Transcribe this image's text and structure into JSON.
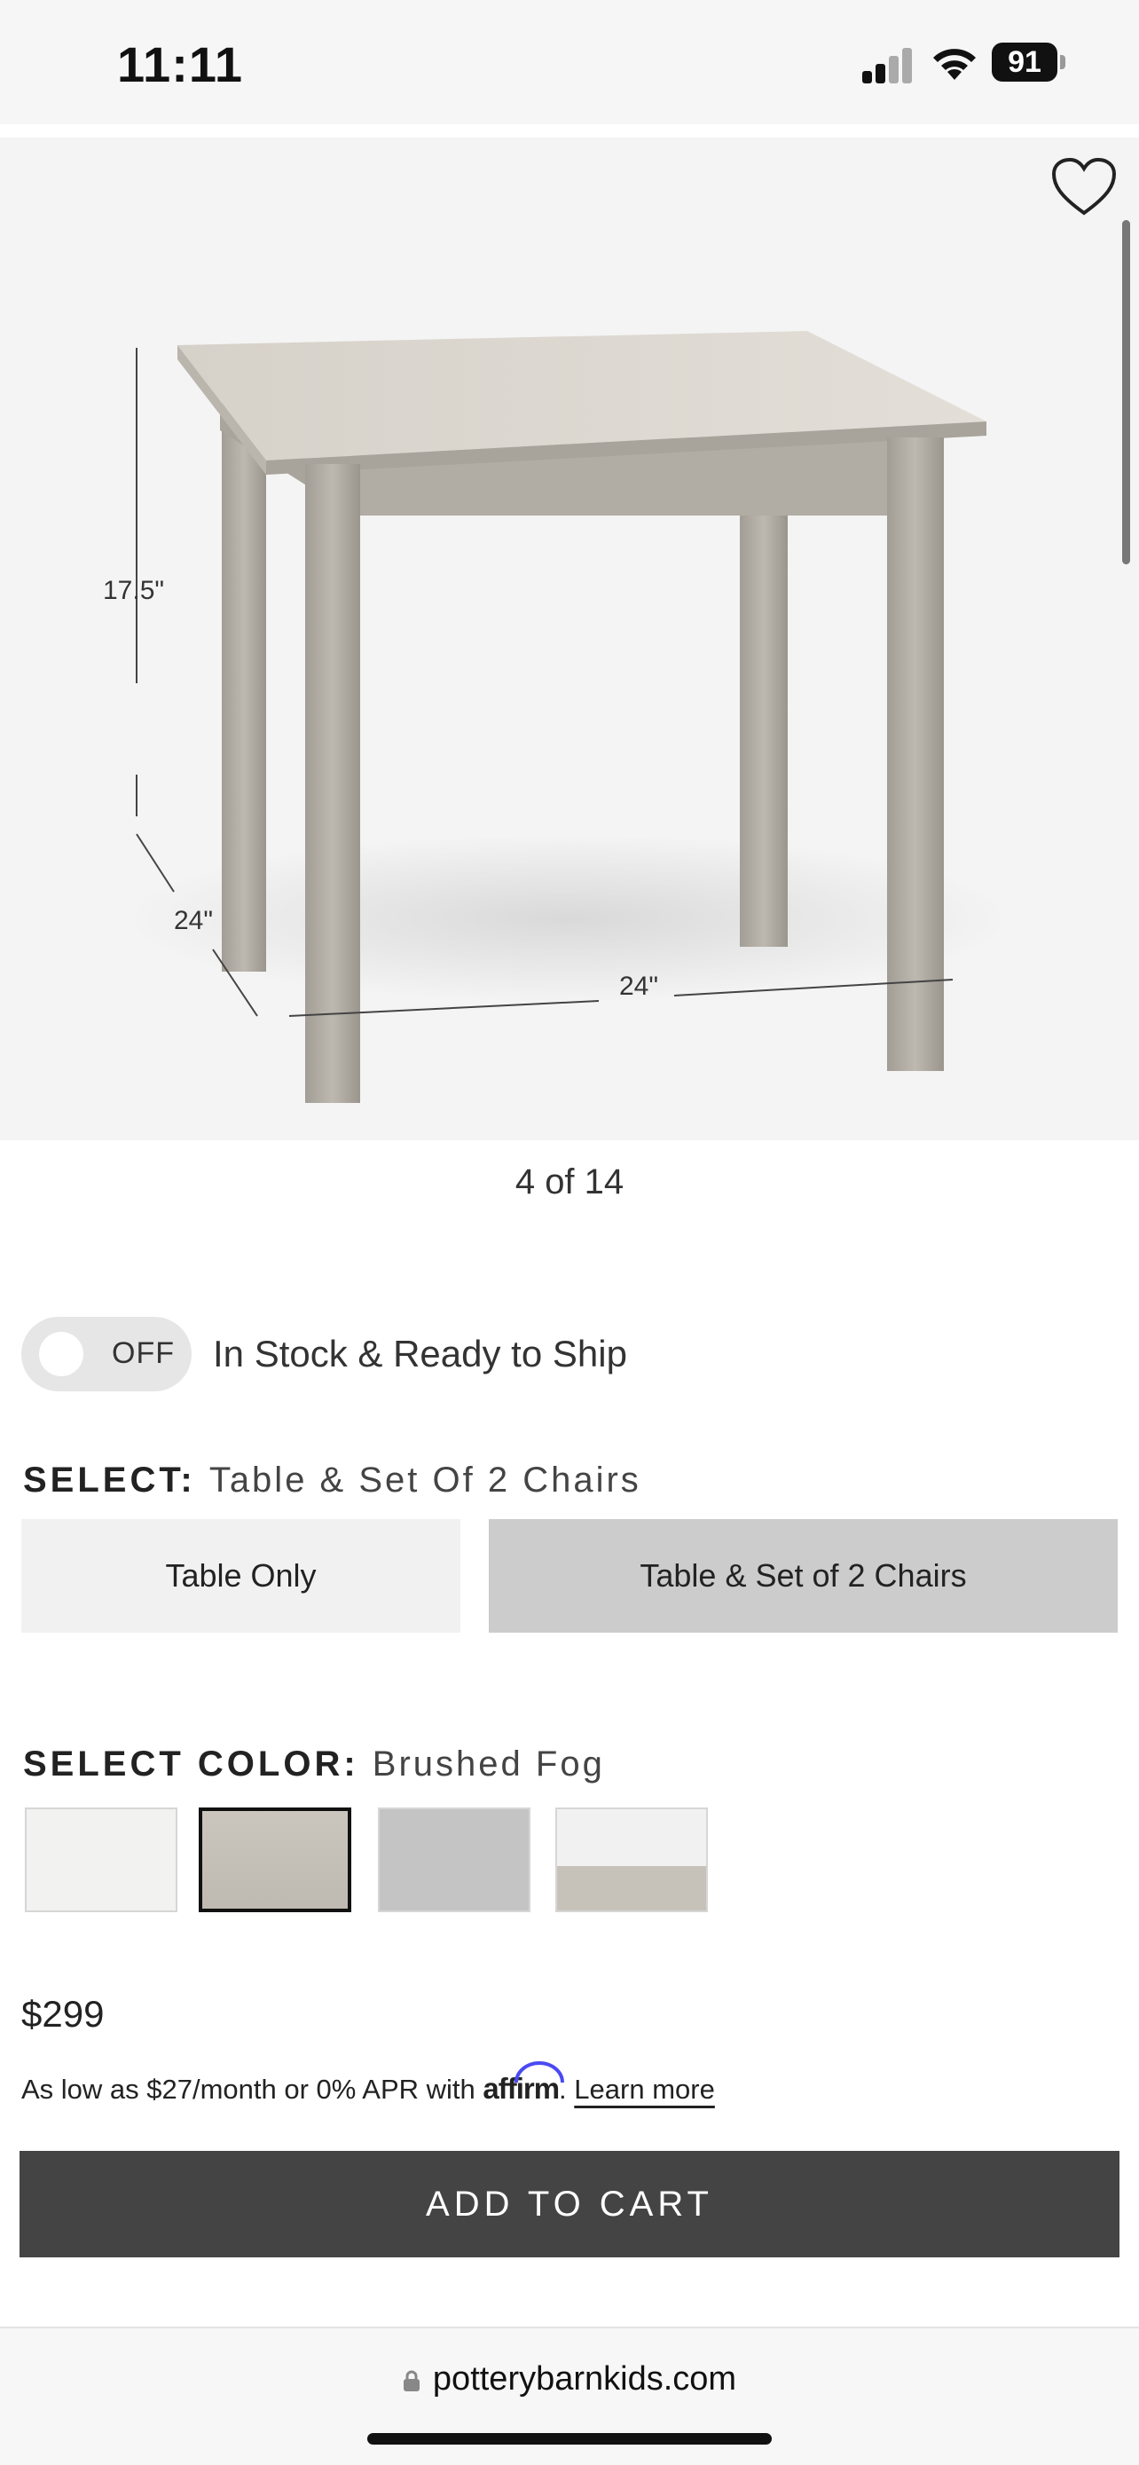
{
  "status_bar": {
    "time": "11:11",
    "battery": "91"
  },
  "gallery": {
    "dimensions": {
      "height": "17.5\"",
      "depth": "24\"",
      "width": "24\""
    },
    "pager": "4 of 14"
  },
  "stock_filter": {
    "toggle_state": "OFF",
    "label": "In Stock & Ready to Ship"
  },
  "select": {
    "label": "SELECT:",
    "value": "Table & Set Of 2 Chairs",
    "options": [
      {
        "label": "Table Only",
        "selected": false
      },
      {
        "label": "Table & Set of 2 Chairs",
        "selected": true
      }
    ]
  },
  "color": {
    "label": "SELECT COLOR:",
    "value": "Brushed Fog",
    "swatches": [
      {
        "color": "#f2f2f0",
        "selected": false
      },
      {
        "color": "#c6c1b8",
        "selected": true
      },
      {
        "color": "#c4c4c4",
        "selected": false
      },
      {
        "color": "#f1f1f1/#c7c2b9",
        "selected": false
      }
    ]
  },
  "pricing": {
    "price": "$299",
    "financing_text": "As low as $27/month or 0% APR with ",
    "affirm_brand": "affirm",
    "period": ".",
    "learn_more": "Learn more"
  },
  "cart": {
    "button_label": "ADD TO CART"
  },
  "browser": {
    "url": "potterybarnkids.com"
  },
  "colors": {
    "cart_button": "#444444",
    "selected_option": "#cccccc",
    "unselected_option": "#f1f1f1",
    "affirm_accent": "#4a4af4"
  }
}
